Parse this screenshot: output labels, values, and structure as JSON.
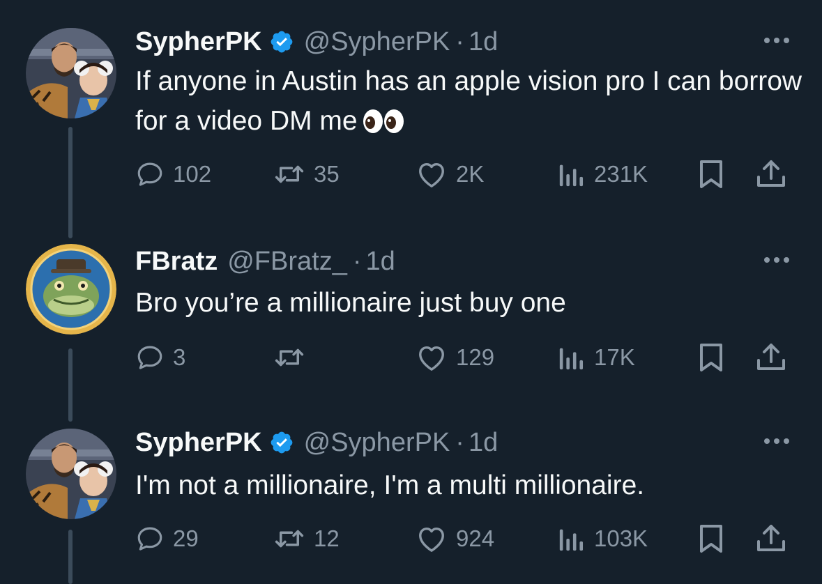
{
  "colors": {
    "background": "#15202b",
    "text_primary": "#f7f9f9",
    "text_secondary": "#8b98a5",
    "verified_blue": "#1d9bf0",
    "thread_line": "#3b4b5a"
  },
  "tweets": [
    {
      "name": "SypherPK",
      "verified": true,
      "handle": "@SypherPK",
      "dot": "·",
      "time": "1d",
      "text": "If anyone in Austin has an apple vision pro I can borrow for a video DM me",
      "emoji": "eyes-emoji",
      "avatar": "sypherpk-avatar",
      "replies": "102",
      "reposts": "35",
      "likes": "2K",
      "views": "231K"
    },
    {
      "name": "FBratz",
      "verified": false,
      "handle": "@FBratz_",
      "dot": "·",
      "time": "1d",
      "text": "Bro you’re a millionaire just buy one",
      "avatar": "fbratz-avatar",
      "replies": "3",
      "reposts": "",
      "likes": "129",
      "views": "17K"
    },
    {
      "name": "SypherPK",
      "verified": true,
      "handle": "@SypherPK",
      "dot": "·",
      "time": "1d",
      "text": "I'm not a millionaire, I'm a multi millionaire.",
      "avatar": "sypherpk-avatar",
      "replies": "29",
      "reposts": "12",
      "likes": "924",
      "views": "103K"
    }
  ],
  "icons": {
    "reply": "reply-icon",
    "repost": "repost-icon",
    "like": "heart-icon",
    "views": "analytics-icon",
    "bookmark": "bookmark-icon",
    "share": "share-icon",
    "more": "more-icon",
    "verified": "verified-badge-icon"
  }
}
